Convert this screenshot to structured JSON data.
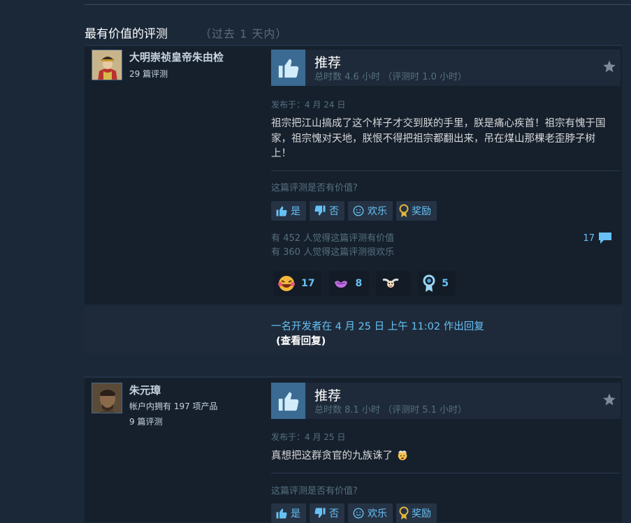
{
  "section": {
    "title": "最有价值的评测",
    "subtitle": "（过去 1 天内）"
  },
  "reviews": [
    {
      "author_name": "大明崇祯皇帝朱由检",
      "author_meta": [
        "29 篇评测"
      ],
      "recommendation": "推荐",
      "hours": "总时数 4.6 小时 （评测时 1.0 小时）",
      "posted": "发布于：4 月 24 日",
      "text": "祖宗把江山搞成了这个样子才交到朕的手里，朕是痛心疾首！祖宗有愧于国家，祖宗愧对天地，朕恨不得把祖宗都翻出来，吊在煤山那棵老歪脖子树上！",
      "helpful_question": "这篇评测是否有价值?",
      "vote_yes": "是",
      "vote_no": "否",
      "vote_funny": "欢乐",
      "vote_award": "奖励",
      "found_helpful": "有 452 人觉得这篇评测有价值",
      "found_funny": "有 360 人觉得这篇评测很欢乐",
      "comment_count": "17",
      "awards": [
        {
          "icon": "laughing-face-icon",
          "count": "17"
        },
        {
          "icon": "purple-lips-icon",
          "count": "8"
        },
        {
          "icon": "winged-face-icon",
          "count": ""
        },
        {
          "icon": "ribbon-medal-icon",
          "count": "5"
        }
      ],
      "dev_reply": {
        "line1": "一名开发者在 4 月 25 日 上午 11:02 作出回复",
        "line2": "(查看回复)"
      }
    },
    {
      "author_name": "朱元璋",
      "author_meta": [
        "帐户内拥有 197 项产品",
        "9 篇评测"
      ],
      "recommendation": "推荐",
      "hours": "总时数 8.1 小时 （评测时 5.1 小时）",
      "posted": "发布于：4 月 25 日",
      "text": "真想把这群贪官的九族诛了",
      "text_emoji": "exploding-head-emoji",
      "helpful_question": "这篇评测是否有价值?",
      "vote_yes": "是",
      "vote_no": "否",
      "vote_funny": "欢乐",
      "vote_award": "奖励"
    }
  ],
  "colors": {
    "background": "#1b2838",
    "panel": "#16202d",
    "accent_blue": "#67c1f5",
    "thumb_box": "#3b6b93"
  }
}
